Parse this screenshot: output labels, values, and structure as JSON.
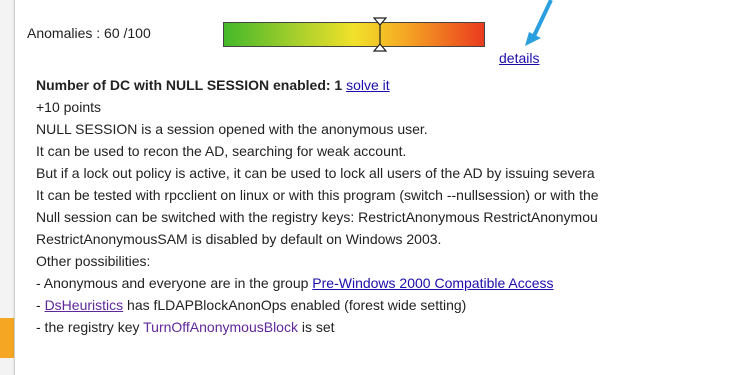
{
  "score": {
    "label": "Anomalies : 60 /100",
    "value": 60,
    "max": 100,
    "gauge_colors": [
      "#44b82a",
      "#f1e12a",
      "#ea3b1f"
    ],
    "details_link": "details"
  },
  "rule": {
    "title": "Number of DC with NULL SESSION enabled: 1",
    "solve_link": "solve it",
    "points": "+10 points",
    "lines": [
      "NULL SESSION is a session opened with the anonymous user.",
      "It can be used to recon the AD, searching for weak account.",
      "But if a lock out policy is active, it can be used to lock all users of the AD by issuing severa",
      "It can be tested with rpcclient on linux or with this program (switch --nullsession) or with the",
      "Null session can be switched with the registry keys: RestrictAnonymous RestrictAnonymou",
      "RestrictAnonymousSAM is disabled by default on Windows 2003.",
      "Other possibilities:"
    ],
    "possibility_1_prefix": "- Anonymous and everyone are in the group ",
    "possibility_1_link": "Pre-Windows 2000 Compatible Access",
    "possibility_2_link": "DsHeuristics",
    "possibility_2_suffix": " has fLDAPBlockAnonOps enabled (forest wide setting)",
    "possibility_3_prefix": "- the registry key ",
    "possibility_3_link": "TurnOffAnonymousBlock",
    "possibility_3_suffix": " is set",
    "possibility_2_prefix": "- "
  },
  "accent_colors": {
    "link": "#1a0dab",
    "visited_link": "#60279b",
    "annotation_arrow": "#2a9fe0",
    "side_tab": "#f5a623"
  }
}
